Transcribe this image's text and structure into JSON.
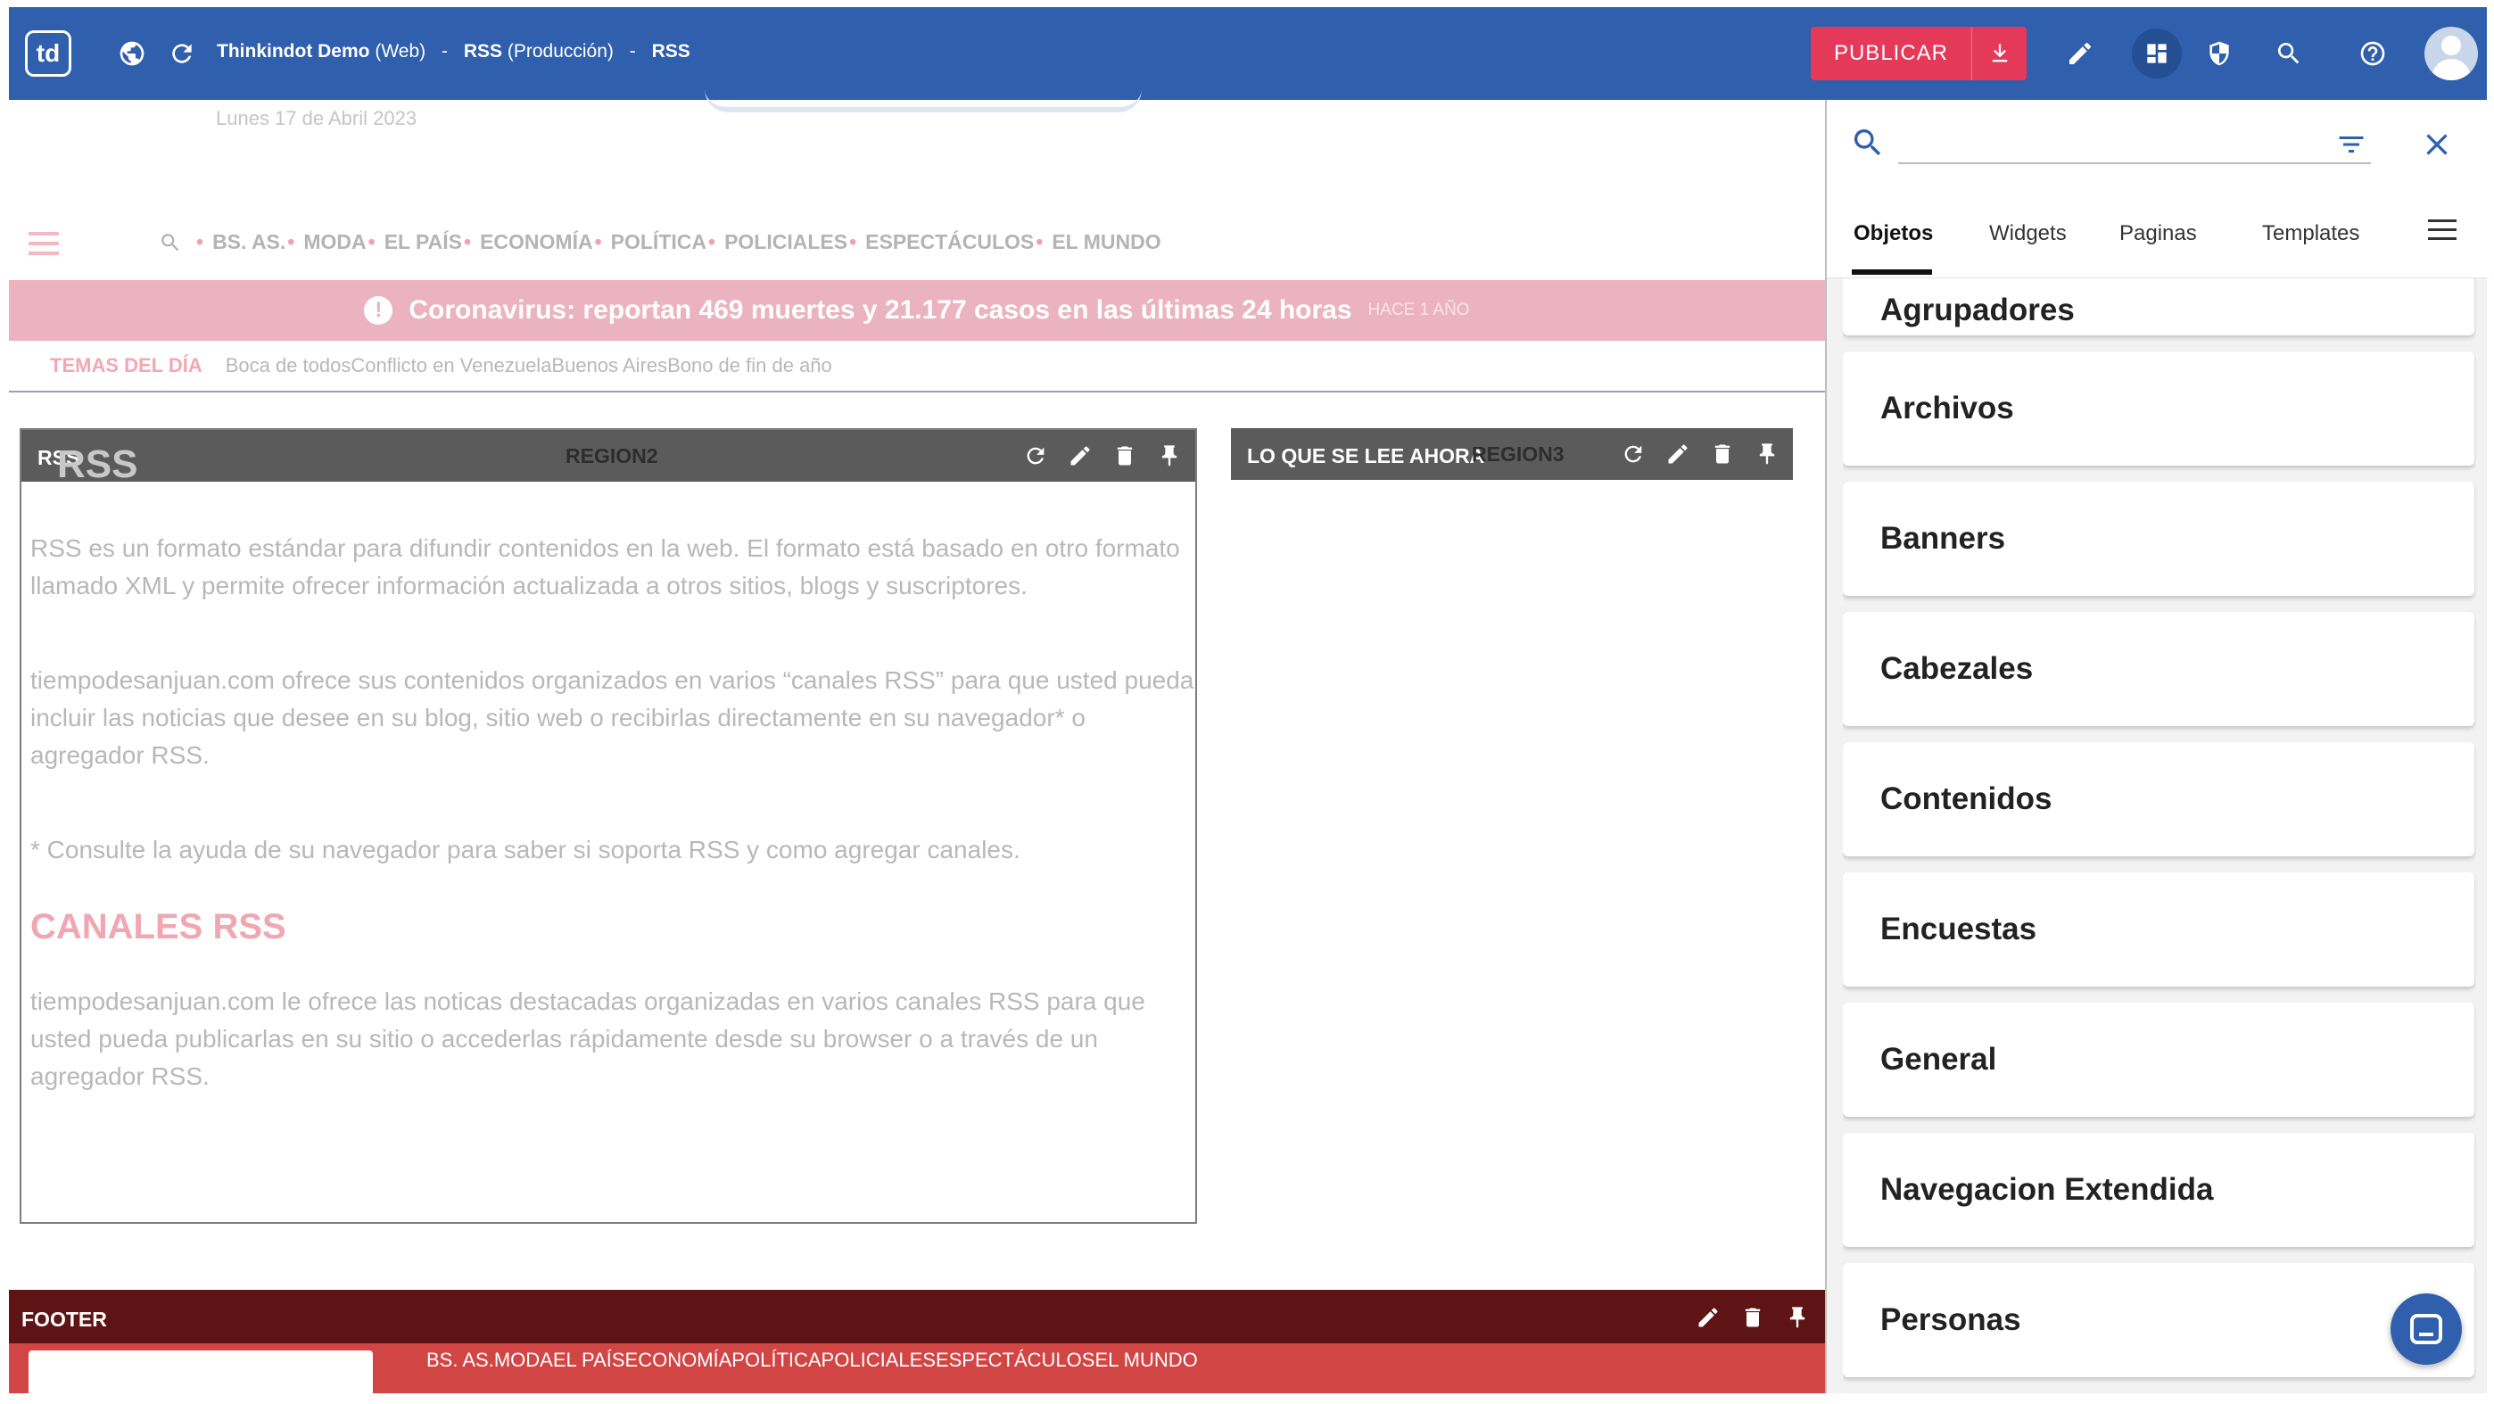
{
  "topbar": {
    "logo": "td",
    "breadcrumb": {
      "site": "Thinkindot Demo",
      "site_env": "(Web)",
      "page": "RSS",
      "page_env": "(Producción)",
      "current": "RSS",
      "separator": "-"
    },
    "publish_label": "PUBLICAR"
  },
  "site": {
    "date": "Lunes 17 de Abril 2023",
    "nav": [
      "BS. AS.",
      "MODA",
      "EL PAÍS",
      "ECONOMÍA",
      "POLÍTICA",
      "POLICIALES",
      "ESPECTÁCULOS",
      "EL MUNDO"
    ],
    "alert": {
      "text": "Coronavirus: reportan 469 muertes y 21.177 casos en las últimas 24 horas",
      "ago": "HACE 1 AÑO"
    },
    "temas": {
      "label": "TEMAS DEL DÍA",
      "items": "Boca de todosConflicto en VenezuelaBuenos AiresBono de fin de año"
    }
  },
  "regions": {
    "rss": {
      "title": "RSS",
      "region": "REGION2",
      "ghost_title": "RSS",
      "p1": "RSS es un formato estándar para difundir contenidos en la web. El formato está basado en otro formato llamado XML y permite ofrecer información actualizada a otros sitios, blogs y suscriptores.",
      "p2": "tiempodesanjuan.com ofrece sus contenidos organizados en varios “canales RSS” para que usted pueda incluir las noticias que desee en su blog, sitio web o recibirlas directamente en su navegador* o agregador RSS.",
      "p3": "* Consulte la ayuda de su navegador para saber si soporta RSS y como agregar canales.",
      "h2": "CANALES RSS",
      "p4": "tiempodesanjuan.com le ofrece las noticas destacadas organizadas en varios canales RSS para que usted pueda publicarlas en su sitio o accederlas rápidamente desde su browser o a través de un agregador RSS."
    },
    "lee": {
      "title": "LO QUE SE LEE AHORA",
      "region": "REGION3"
    },
    "footer": {
      "title": "FOOTER",
      "links": "BS. AS.MODAEL PAÍSECONOMÍAPOLÍTICAPOLICIALESESPECTÁCULOSEL MUNDO"
    }
  },
  "panel": {
    "search_value": "",
    "tabs": [
      "Objetos",
      "Widgets",
      "Paginas",
      "Templates"
    ],
    "active_tab": "Objetos",
    "categories": [
      "Agrupadores",
      "Archivos",
      "Banners",
      "Cabezales",
      "Contenidos",
      "Encuestas",
      "General",
      "Navegacion Extendida",
      "Personas"
    ]
  },
  "colors": {
    "topbar": "#2f5fad",
    "publish": "#e5395a",
    "region_bar": "#5b5b5b",
    "footer_bar": "#5e1414",
    "footer_strip": "#d14545",
    "alert": "#eab3bf"
  },
  "icons": {
    "topbar": [
      "globe-icon",
      "refresh-icon",
      "download-icon",
      "pencil-icon",
      "dashboard-icon",
      "shield-icon",
      "search-icon",
      "help-icon",
      "avatar"
    ],
    "region_tools": [
      "refresh-icon",
      "pencil-icon",
      "trash-icon",
      "pin-icon"
    ],
    "panel": [
      "search-icon",
      "filter-icon",
      "close-icon",
      "menu-icon",
      "chat-icon"
    ]
  }
}
